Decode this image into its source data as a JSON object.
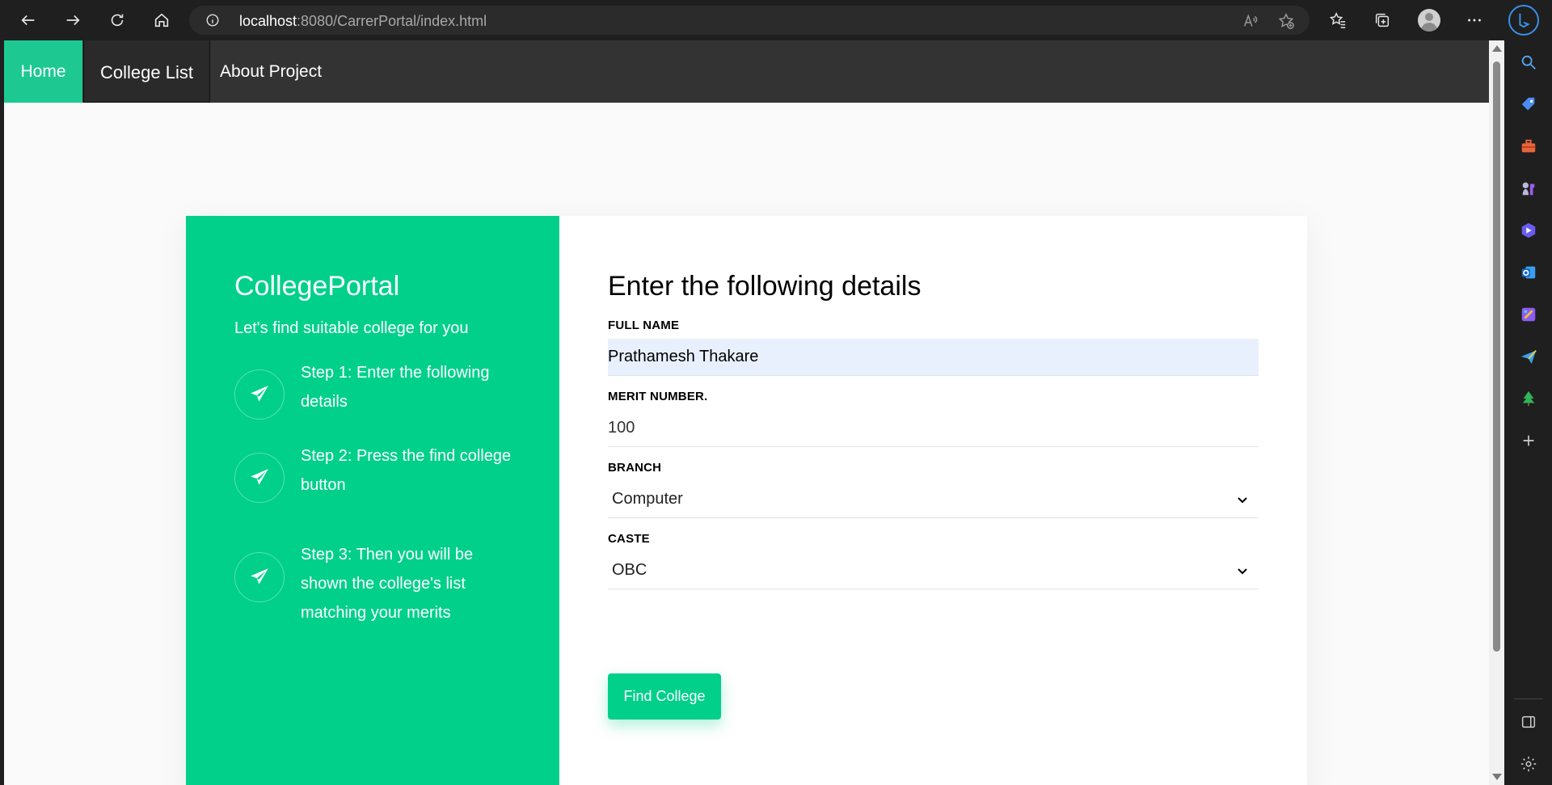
{
  "browser": {
    "url_host": "localhost",
    "url_path": ":8080/CarrerPortal/index.html"
  },
  "site_nav": {
    "items": [
      {
        "label": "Home"
      },
      {
        "label": "College List"
      },
      {
        "label": "About Project"
      }
    ]
  },
  "sidebar_panel": {
    "brand": "CollegePortal",
    "tagline": "Let's find suitable college for you",
    "steps": [
      {
        "label": "Step 1:",
        "text": " Enter the following details"
      },
      {
        "label": "Step 2:",
        "text": " Press the find college button"
      },
      {
        "label": "Step 3:",
        "text": " Then you will be shown the college's list matching your merits"
      }
    ]
  },
  "form": {
    "title": "Enter the following details",
    "full_name": {
      "label": "FULL NAME",
      "value": "Prathamesh Thakare"
    },
    "merit": {
      "label": "MERIT NUMBER.",
      "value": "100"
    },
    "branch": {
      "label": "BRANCH",
      "value": "Computer"
    },
    "caste": {
      "label": "CASTE",
      "value": "OBC"
    },
    "submit_label": "Find College"
  },
  "colors": {
    "accent": "#00d08a",
    "nav_bg": "#333333",
    "home_tab": "#1dc991"
  }
}
